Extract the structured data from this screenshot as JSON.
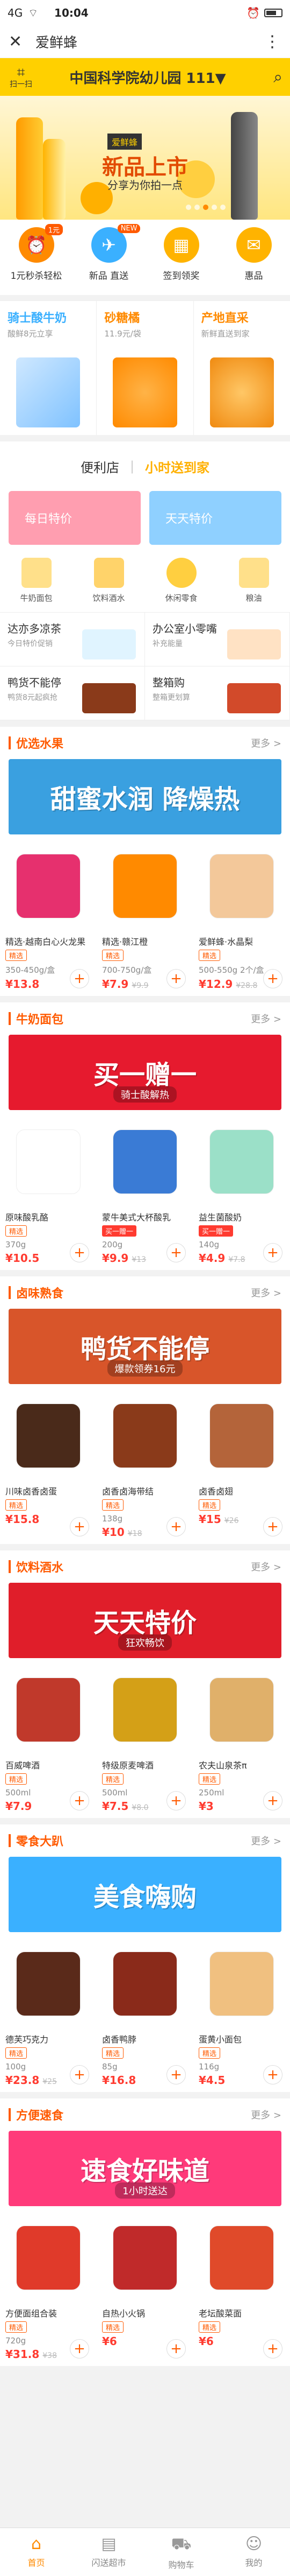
{
  "status": {
    "left": "4G",
    "time": "10:04",
    "right": ""
  },
  "titlebar": {
    "title": "爱鲜蜂"
  },
  "header": {
    "scan_label": "扫一扫",
    "shop_name": "中国科学院幼儿园 111▼"
  },
  "banner": {
    "tag": "爱鲜蜂",
    "headline": "新品上市",
    "sub": "分享为你拍一点"
  },
  "quicknav": [
    {
      "label": "1元秒杀轻松",
      "icon": "alarm-icon",
      "color": "#ff8a00",
      "badge": "1元"
    },
    {
      "label": "新品 直送",
      "icon": "plane-icon",
      "color": "#3ab0ff",
      "badge": "NEW"
    },
    {
      "label": "签到领奖",
      "icon": "calendar-icon",
      "color": "#ffb300",
      "badge": ""
    },
    {
      "label": "惠品",
      "icon": "gift-icon",
      "color": "#ffb300",
      "badge": ""
    }
  ],
  "promos": [
    {
      "title": "骑士酸牛奶",
      "sub": "酸鲜8元立享",
      "color": "#3ab0ff"
    },
    {
      "title": "砂糖橘",
      "sub": "11.9元/袋",
      "color": "#ff8a00"
    },
    {
      "title": "产地直采",
      "sub": "新鲜直送到家",
      "color": "#ff8a00"
    }
  ],
  "convenience": {
    "title": "便利店",
    "logo_text": "小时送到家",
    "tiles": [
      "每日特价",
      "天天特价"
    ],
    "icons": [
      "牛奶面包",
      "饮料酒水",
      "休闲零食",
      "粮油"
    ],
    "grid": [
      {
        "title": "达亦多凉茶",
        "sub": "今日特价促销"
      },
      {
        "title": "办公室小零嘴",
        "sub": "补充能量"
      },
      {
        "title": "鸭货不能停",
        "sub": "鸭货8元起疯抢"
      },
      {
        "title": "整箱购",
        "sub": "整箱更划算"
      }
    ]
  },
  "sections": [
    {
      "name": "优选水果",
      "more": "更多 >",
      "banner_text": "甜蜜水润 降燥热",
      "banner_sub": "",
      "banner_color": "#3aa0e0",
      "products": [
        {
          "name": "精选·越南白心火龙果",
          "spec": "350-450g/盒",
          "price": "¥13.8",
          "old": "",
          "pic": "#e6306e",
          "tag": "精选"
        },
        {
          "name": "精选·赣江橙",
          "spec": "700-750g/盒",
          "price": "¥7.9",
          "old": "¥9.9",
          "pic": "#ff8a00",
          "tag": "精选"
        },
        {
          "name": "爱鲜蜂·水晶梨",
          "spec": "500-550g 2个/盒",
          "price": "¥12.9",
          "old": "¥28.8",
          "pic": "#f3c89a",
          "tag": "精选"
        }
      ]
    },
    {
      "name": "牛奶面包",
      "more": "更多 >",
      "banner_text": "买一赠一",
      "banner_sub": "骑士酸解热",
      "banner_color": "#e61a2e",
      "products": [
        {
          "name": "原味酸乳酪",
          "spec": "370g",
          "price": "¥10.5",
          "old": "",
          "pic": "#ffffff",
          "tag": "精选"
        },
        {
          "name": "蒙牛美式大杯酸乳",
          "spec": "200g",
          "price": "¥9.9",
          "old": "¥13",
          "pic": "#3a7bd5",
          "tag": "买一赠一"
        },
        {
          "name": "益生菌酸奶",
          "spec": "140g",
          "price": "¥4.9",
          "old": "¥7.8",
          "pic": "#9be0c8",
          "tag": "买一赠一"
        }
      ]
    },
    {
      "name": "卤味熟食",
      "more": "更多 >",
      "banner_text": "鸭货不能停",
      "banner_sub": "爆款领券16元",
      "banner_color": "#d8552a",
      "products": [
        {
          "name": "川味卤香卤蛋",
          "spec": "",
          "price": "¥15.8",
          "old": "",
          "pic": "#4a2a1a",
          "tag": "精选"
        },
        {
          "name": "卤香卤海带结",
          "spec": "138g",
          "price": "¥10",
          "old": "¥18",
          "pic": "#8a3a1a",
          "tag": "精选"
        },
        {
          "name": "卤香卤翅",
          "spec": "",
          "price": "¥15",
          "old": "¥26",
          "pic": "#b4643a",
          "tag": "精选"
        }
      ]
    },
    {
      "name": "饮料酒水",
      "more": "更多 >",
      "banner_text": "天天特价",
      "banner_sub": "狂欢畅饮",
      "banner_color": "#e01e2a",
      "products": [
        {
          "name": "百威啤酒",
          "spec": "500ml",
          "price": "¥7.9",
          "old": "",
          "pic": "#c0392b",
          "tag": "精选"
        },
        {
          "name": "特级原麦啤酒",
          "spec": "500ml",
          "price": "¥7.5",
          "old": "¥8.0",
          "pic": "#d4a017",
          "tag": "精选"
        },
        {
          "name": "农夫山泉茶π",
          "spec": "250ml",
          "price": "¥3",
          "old": "",
          "pic": "#e0b06a",
          "tag": "精选"
        }
      ]
    },
    {
      "name": "零食大趴",
      "more": "更多 >",
      "banner_text": "美食嗨购",
      "banner_sub": "",
      "banner_color": "#3ab0ff",
      "products": [
        {
          "name": "德芙巧克力",
          "spec": "100g",
          "price": "¥23.8",
          "old": "¥25",
          "pic": "#5a2a1a",
          "tag": "精选"
        },
        {
          "name": "卤香鸭脖",
          "spec": "85g",
          "price": "¥16.8",
          "old": "",
          "pic": "#8a2a1a",
          "tag": "精选"
        },
        {
          "name": "蛋黄小面包",
          "spec": "116g",
          "price": "¥4.5",
          "old": "",
          "pic": "#f0c080",
          "tag": "精选"
        }
      ]
    },
    {
      "name": "方便速食",
      "more": "更多 >",
      "banner_text": "速食好味道",
      "banner_sub": "1小时送达",
      "banner_color": "#ff3a7a",
      "products": [
        {
          "name": "方便面组合装",
          "spec": "720g",
          "price": "¥31.8",
          "old": "¥38",
          "pic": "#e03a2a",
          "tag": "精选"
        },
        {
          "name": "自热小火锅",
          "spec": "",
          "price": "¥6",
          "old": "",
          "pic": "#c02a2a",
          "tag": "精选"
        },
        {
          "name": "老坛酸菜面",
          "spec": "",
          "price": "¥6",
          "old": "",
          "pic": "#e04a2a",
          "tag": "精选"
        }
      ]
    }
  ],
  "tabbar": [
    {
      "label": "首页",
      "icon": "home-icon",
      "active": true
    },
    {
      "label": "闪送超市",
      "icon": "store-icon",
      "active": false
    },
    {
      "label": "购物车",
      "icon": "cart-icon",
      "active": false
    },
    {
      "label": "我的",
      "icon": "user-icon",
      "active": false
    }
  ]
}
